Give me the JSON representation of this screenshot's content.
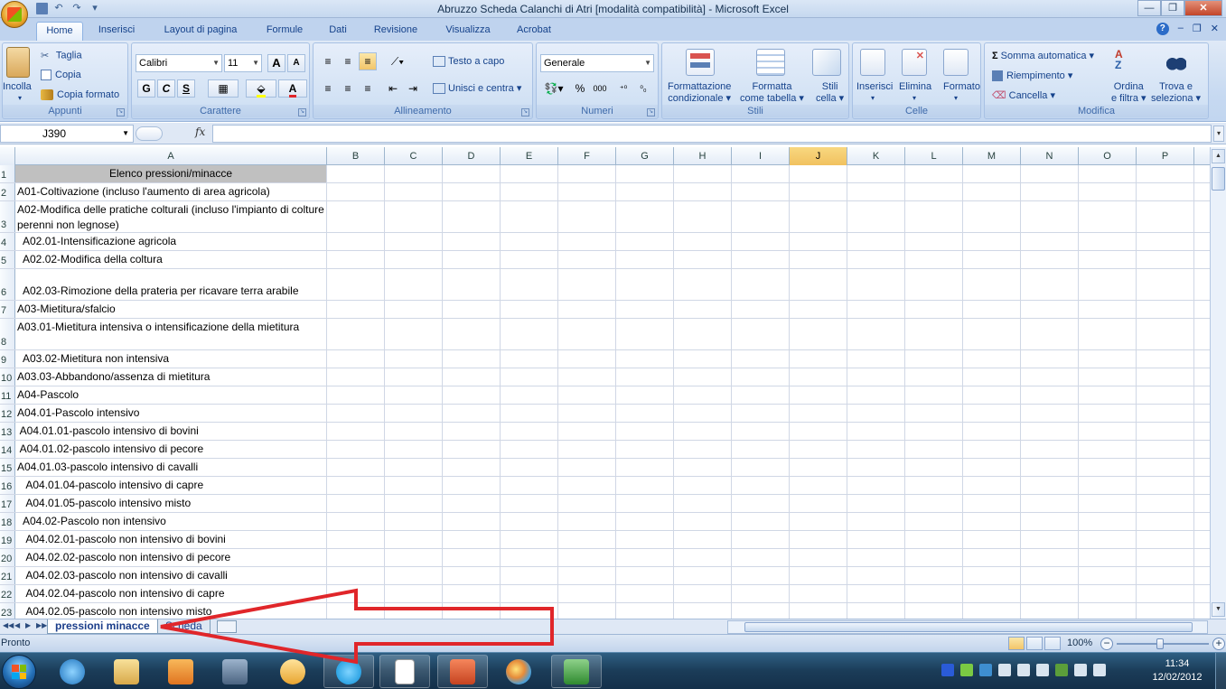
{
  "window": {
    "title": "Abruzzo Scheda Calanchi di Atri  [modalità compatibilità] - Microsoft Excel",
    "controls": [
      "minimize",
      "restore",
      "close"
    ]
  },
  "ribbon_tabs": [
    "Home",
    "Inserisci",
    "Layout di pagina",
    "Formule",
    "Dati",
    "Revisione",
    "Visualizza",
    "Acrobat"
  ],
  "ribbon": {
    "appunti": {
      "label": "Appunti",
      "incolla": "Incolla",
      "taglia": "Taglia",
      "copia": "Copia",
      "copia_formato": "Copia formato"
    },
    "carattere": {
      "label": "Carattere",
      "font": "Calibri",
      "size": "11",
      "bold": "G",
      "italic": "C",
      "underline": "S"
    },
    "allineamento": {
      "label": "Allineamento",
      "testo_a_capo": "Testo a capo",
      "unisci": "Unisci e centra"
    },
    "numeri": {
      "label": "Numeri",
      "format": "Generale",
      "percent": "%",
      "thousands": "000"
    },
    "stili": {
      "label": "Stili",
      "formattazione": [
        "Formattazione",
        "condizionale"
      ],
      "formatta": [
        "Formatta",
        "come tabella"
      ],
      "stili_cella": [
        "Stili",
        "cella"
      ]
    },
    "celle": {
      "label": "Celle",
      "inserisci": "Inserisci",
      "elimina": "Elimina",
      "formato": "Formato"
    },
    "modifica": {
      "label": "Modifica",
      "somma": "Somma automatica",
      "riempimento": "Riempimento",
      "cancella": "Cancella",
      "ordina": [
        "Ordina",
        "e filtra"
      ],
      "trova": [
        "Trova e",
        "seleziona"
      ]
    }
  },
  "formula_bar": {
    "name_box": "J390",
    "fx": "fx",
    "value": ""
  },
  "columns": [
    "A",
    "B",
    "C",
    "D",
    "E",
    "F",
    "G",
    "H",
    "I",
    "J",
    "K",
    "L",
    "M",
    "N",
    "O",
    "P"
  ],
  "selected_column": "J",
  "rows": [
    {
      "n": "1",
      "text": "Elenco pressioni/minacce"
    },
    {
      "n": "2",
      "text": "A01-Coltivazione (incluso l'aumento di area agricola)"
    },
    {
      "n": "3",
      "text": "A02-Modifica delle pratiche colturali (incluso l'impianto di colture perenni non legnose)"
    },
    {
      "n": "4",
      "text": "  A02.01-Intensificazione agricola"
    },
    {
      "n": "5",
      "text": "  A02.02-Modifica della coltura"
    },
    {
      "n": "6",
      "text": "  A02.03-Rimozione della prateria per ricavare terra arabile"
    },
    {
      "n": "7",
      "text": "A03-Mietitura/sfalcio"
    },
    {
      "n": "8",
      "text": "   A03.01-Mietitura intensiva o intensificazione della mietitura"
    },
    {
      "n": "9",
      "text": "  A03.02-Mietitura non intensiva"
    },
    {
      "n": "10",
      "text": "A03.03-Abbandono/assenza di mietitura"
    },
    {
      "n": "11",
      "text": "A04-Pascolo"
    },
    {
      "n": "12",
      "text": "A04.01-Pascolo intensivo"
    },
    {
      "n": "13",
      "text": " A04.01.01-pascolo intensivo di bovini"
    },
    {
      "n": "14",
      "text": " A04.01.02-pascolo intensivo di pecore"
    },
    {
      "n": "15",
      "text": "A04.01.03-pascolo intensivo di cavalli"
    },
    {
      "n": "16",
      "text": "   A04.01.04-pascolo intensivo di capre"
    },
    {
      "n": "17",
      "text": "   A04.01.05-pascolo intensivo misto"
    },
    {
      "n": "18",
      "text": "  A04.02-Pascolo non intensivo"
    },
    {
      "n": "19",
      "text": "   A04.02.01-pascolo non intensivo di bovini"
    },
    {
      "n": "20",
      "text": "   A04.02.02-pascolo non intensivo di pecore"
    },
    {
      "n": "21",
      "text": "   A04.02.03-pascolo non intensivo di cavalli"
    },
    {
      "n": "22",
      "text": "   A04.02.04-pascolo non intensivo di capre"
    },
    {
      "n": "23",
      "text": "   A04.02.05-pascolo non intensivo misto"
    }
  ],
  "sheets": {
    "active": "pressioni minacce",
    "other": "Scheda"
  },
  "status": {
    "text": "Pronto",
    "zoom": "100%"
  },
  "taskbar": {
    "time": "11:34",
    "date": "12/02/2012"
  },
  "colors": {
    "accent": "#15428b",
    "selected_header": "#f1c15f",
    "header_cell": "#c0c0c0",
    "arrow": "#e0262a"
  }
}
